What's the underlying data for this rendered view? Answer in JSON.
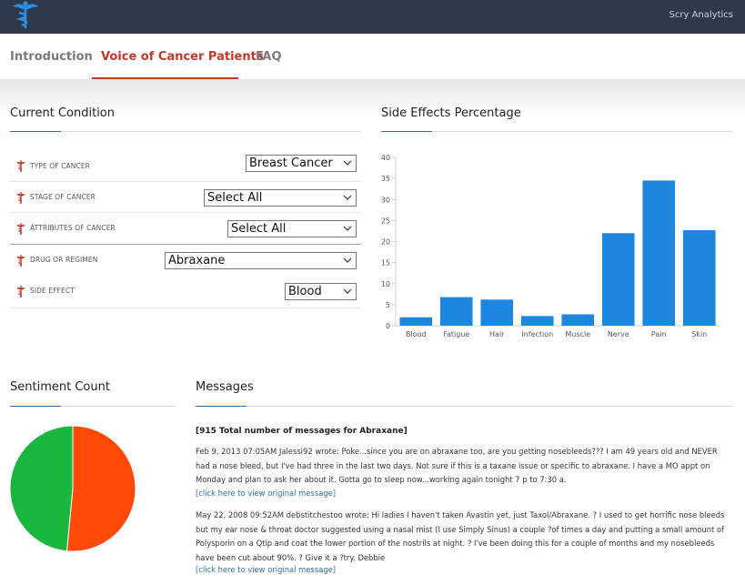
{
  "header": {
    "brand": "Scry Analytics",
    "accent_color": "#2e6da4",
    "bar_color": "#2e3a4b"
  },
  "tabs": [
    {
      "label": "Introduction",
      "active": false
    },
    {
      "label": "Voice of Cancer Patients",
      "active": true
    },
    {
      "label": "FAQ",
      "active": false
    }
  ],
  "condition": {
    "title": "Current Condition",
    "rows": [
      {
        "label": "TYPE OF CANCER",
        "value": "Breast Cancer"
      },
      {
        "label": "STAGE OF CANCER",
        "value": "Select All"
      },
      {
        "label": "ATTRIBUTES OF CANCER",
        "value": "Select All"
      },
      {
        "label": "DRUG OR REGIMEN",
        "value": "Abraxane"
      },
      {
        "label": "SIDE EFFECT",
        "value": "Blood"
      }
    ]
  },
  "side_effects": {
    "title": "Side Effects Percentage"
  },
  "chart_data": [
    {
      "type": "bar",
      "categories": [
        "Blood",
        "Fatigue",
        "Hair",
        "Infection",
        "Muscle",
        "Nerve",
        "Pain",
        "Skin"
      ],
      "values": [
        2,
        6.8,
        6.2,
        2.3,
        2.7,
        22,
        34.5,
        22.7
      ],
      "ylim": [
        0,
        40
      ],
      "yticks": [
        0,
        5,
        10,
        15,
        20,
        25,
        30,
        35,
        40
      ],
      "color": "#1f86e0",
      "grid": false
    },
    {
      "type": "pie",
      "values": [
        51.5,
        48.5
      ],
      "colors": [
        "#ff4a0a",
        "#1ab73f"
      ]
    }
  ],
  "sentiment": {
    "title": "Sentiment Count"
  },
  "messages": {
    "title": "Messages",
    "summary": "[915 Total number of messages for Abraxane]",
    "items": [
      {
        "text": "Feb 9, 2013 07:05AM Jalessi92 wrote: Poke...since you are on abraxane too, are you getting nosebleeds??? I am 49 years old and NEVER had a nose bleed, but I've had three in the last two days. Not sure if this is a taxane issue or specific to abraxane. I have a MO appt on Monday and plan to ask her about it. Gotta go to sleep now...working again tonight 7 p to 7:30 a.",
        "link": "[click here to view original message]"
      },
      {
        "text": "May 22, 2008 09:52AM debstitchestoo wrote: Hi ladies I haven't taken Avastin yet, just Taxol/Abraxane. ? I used to get horrific nose bleeds but my ear nose & throat doctor suggested using a nasal mist (I use Simply Sinus) a couple ?of times a day and putting a small amount of Polysporin on a Qtip and coat the lower portion of the nostrils at night. ? I've been doing this for a couple of months and my nosebleeds have been cut about 90%. ? Give it a ?try. Debbie",
        "link": "[click here to view original message]"
      }
    ]
  },
  "icons": {
    "logo": "caduceus-logo",
    "row_icon": "caduceus-icon",
    "select_arrow": "chevron-down-icon"
  }
}
